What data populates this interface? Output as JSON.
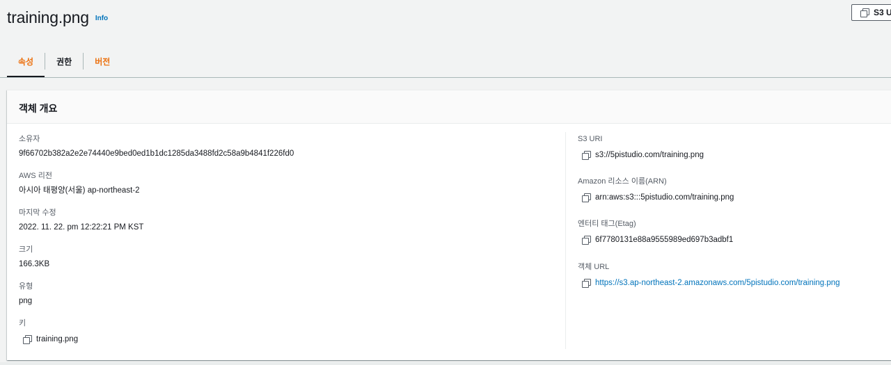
{
  "header": {
    "title": "training.png",
    "info_label": "Info",
    "s3_uri_button": "S3 U"
  },
  "tabs": [
    {
      "label": "속성",
      "state": "active"
    },
    {
      "label": "권한",
      "state": "normal"
    },
    {
      "label": "버전",
      "state": "normal"
    }
  ],
  "overview": {
    "title": "객체 개요",
    "left": {
      "owner": {
        "label": "소유자",
        "value": "9f66702b382a2e2e74440e9bed0ed1b1dc1285da3488fd2c58a9b4841f226fd0"
      },
      "region": {
        "label": "AWS 리전",
        "value": "아시아 태평양(서울) ap-northeast-2"
      },
      "modified": {
        "label": "마지막 수정",
        "value": "2022. 11. 22. pm 12:22:21 PM KST"
      },
      "size": {
        "label": "크기",
        "value": "166.3KB"
      },
      "type": {
        "label": "유형",
        "value": "png"
      },
      "key": {
        "label": "키",
        "value": "training.png"
      }
    },
    "right": {
      "s3_uri": {
        "label": "S3 URI",
        "value": "s3://5pistudio.com/training.png"
      },
      "arn": {
        "label": "Amazon 리소스 이름(ARN)",
        "value": "arn:aws:s3:::5pistudio.com/training.png"
      },
      "etag": {
        "label": "엔터티 태그(Etag)",
        "value": "6f7780131e88a9555989ed697b3adbf1"
      },
      "object_url": {
        "label": "객체 URL",
        "value": "https://s3.ap-northeast-2.amazonaws.com/5pistudio.com/training.png"
      }
    }
  },
  "colors": {
    "accent_orange": "#ec7211",
    "link_blue": "#0073bb",
    "text": "#16191f",
    "label": "#545b64",
    "background": "#f2f3f3"
  }
}
